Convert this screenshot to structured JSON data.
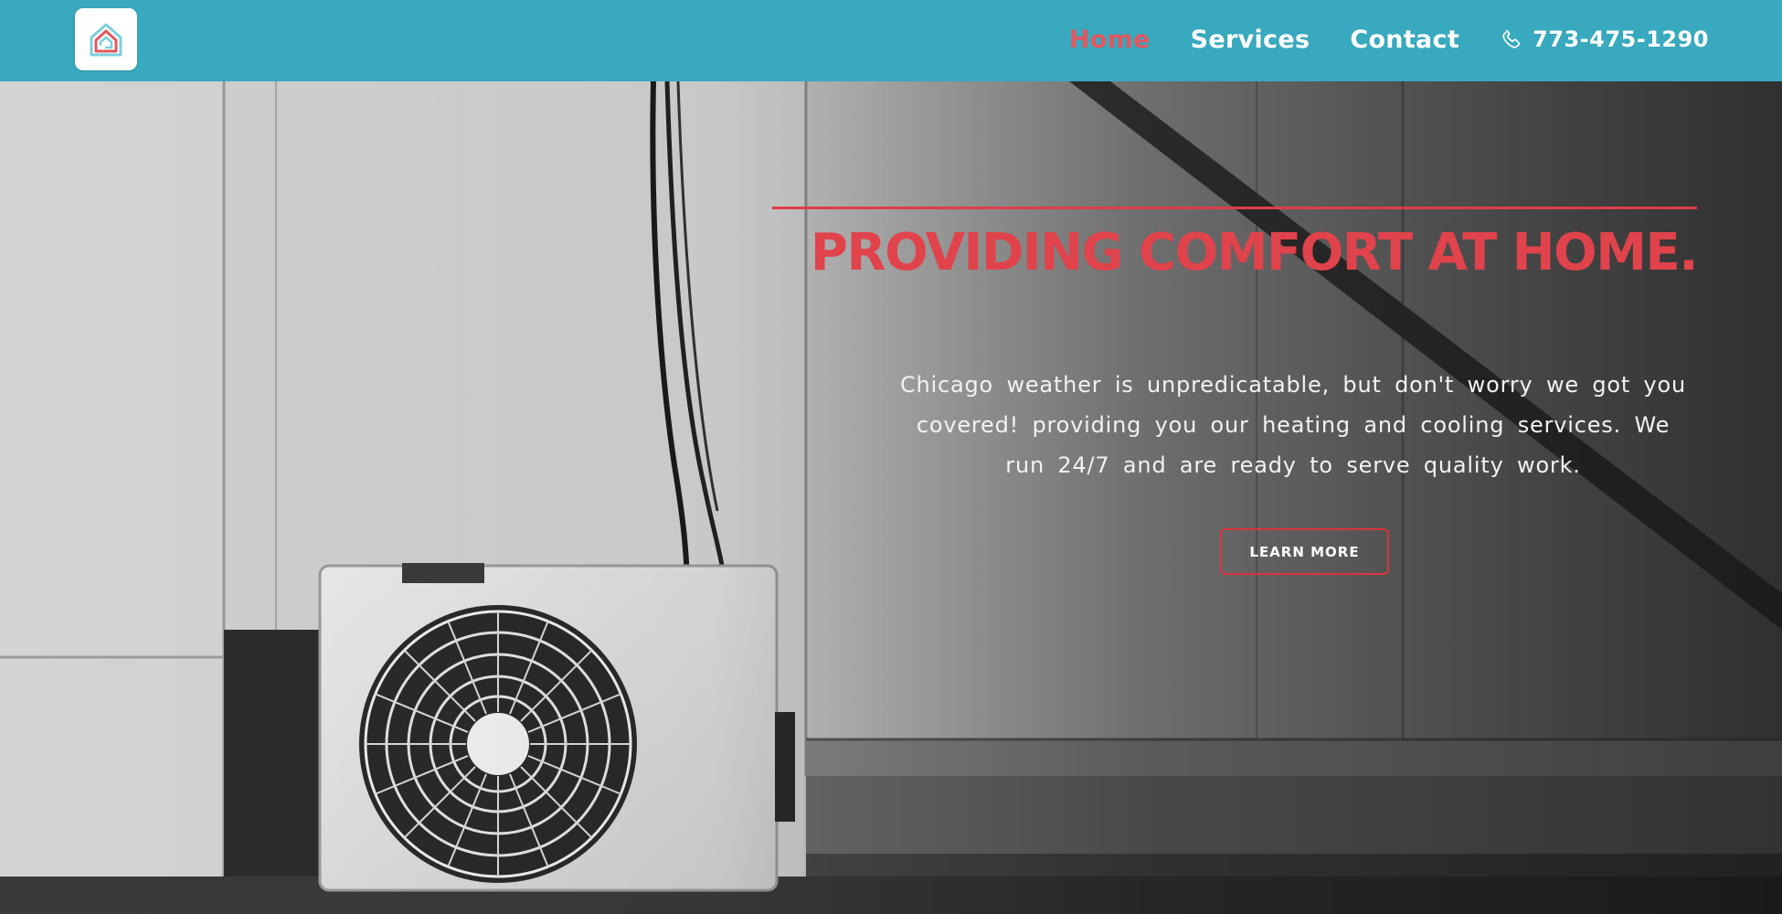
{
  "header": {
    "logo_icon": "house-icon",
    "nav": [
      {
        "label": "Home",
        "active": true
      },
      {
        "label": "Services",
        "active": false
      },
      {
        "label": "Contact",
        "active": false
      }
    ],
    "phone": {
      "icon": "phone-icon",
      "number": "773-475-1290"
    }
  },
  "hero": {
    "image": "outdoor-ac-unit-photo",
    "headline": "PROVIDING COMFORT AT HOME.",
    "tagline": "Chicago weather is unpredicatable, but don't worry we got you covered! providing you our heating and cooling services. We run 24/7 and are ready to serve quality work.",
    "cta_label": "LEARN MORE"
  },
  "colors": {
    "header_bg": "#38a9bf",
    "accent_red": "#e0434b",
    "nav_text": "#ffffff"
  }
}
